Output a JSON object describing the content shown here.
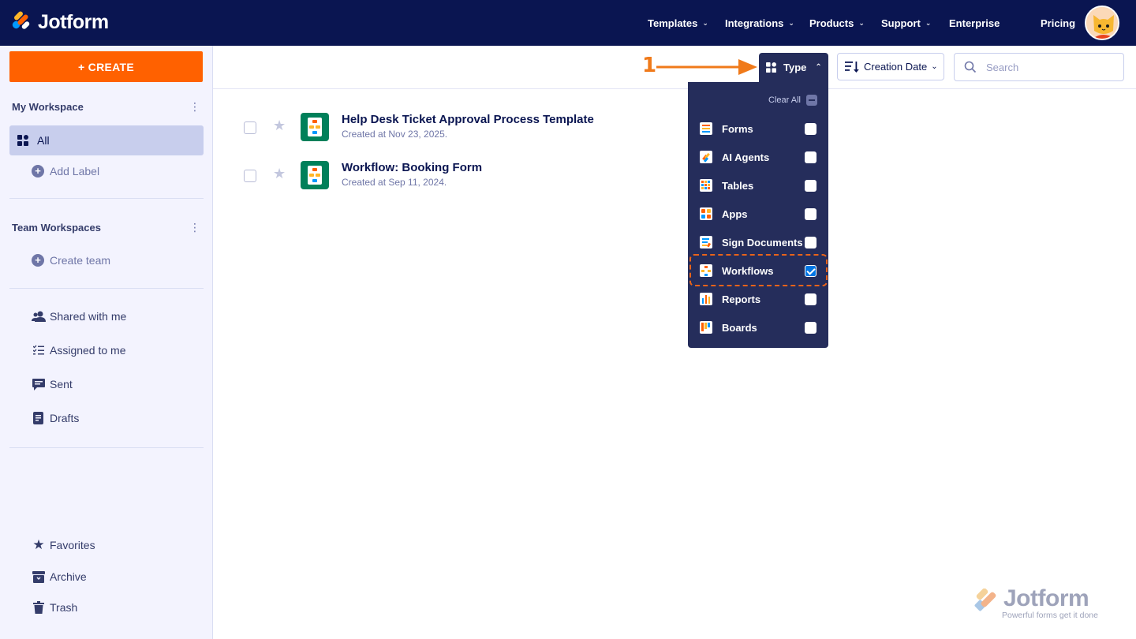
{
  "header": {
    "brand": "Jotform",
    "nav": [
      {
        "label": "Templates",
        "chevron": true
      },
      {
        "label": "Integrations",
        "chevron": true
      },
      {
        "label": "Products",
        "chevron": true
      },
      {
        "label": "Support",
        "chevron": true
      },
      {
        "label": "Enterprise",
        "chevron": false
      },
      {
        "label": "Pricing",
        "chevron": false
      }
    ],
    "avatar_icon": "user-avatar"
  },
  "sidebar": {
    "create_label": "+ CREATE",
    "my_workspace_title": "My Workspace",
    "all_label": "All",
    "add_label": "Add Label",
    "team_workspaces_title": "Team Workspaces",
    "create_team": "Create team",
    "shared_with_me": "Shared with me",
    "assigned_to_me": "Assigned to me",
    "sent": "Sent",
    "drafts": "Drafts",
    "favorites": "Favorites",
    "archive": "Archive",
    "trash": "Trash"
  },
  "toolbar": {
    "type_label": "Type",
    "sort_label": "Creation Date",
    "search_placeholder": "Search"
  },
  "annotation": {
    "step": "1",
    "color": "#f07a1a"
  },
  "type_filter": {
    "clear_all": "Clear All",
    "options": [
      {
        "label": "Forms",
        "checked": false,
        "icon": "forms-icon"
      },
      {
        "label": "AI Agents",
        "checked": false,
        "icon": "ai-agents-icon"
      },
      {
        "label": "Tables",
        "checked": false,
        "icon": "tables-icon"
      },
      {
        "label": "Apps",
        "checked": false,
        "icon": "apps-icon"
      },
      {
        "label": "Sign Documents",
        "checked": false,
        "icon": "sign-documents-icon"
      },
      {
        "label": "Workflows",
        "checked": true,
        "icon": "workflows-icon"
      },
      {
        "label": "Reports",
        "checked": false,
        "icon": "reports-icon"
      },
      {
        "label": "Boards",
        "checked": false,
        "icon": "boards-icon"
      }
    ]
  },
  "items": [
    {
      "title": "Help Desk Ticket Approval Process Template",
      "created": "Created at Nov 23, 2025."
    },
    {
      "title": "Workflow: Booking Form",
      "created": "Created at Sep 11, 2024."
    }
  ],
  "watermark": {
    "brand": "Jotform",
    "tagline": "Powerful forms get it done"
  },
  "colors": {
    "navy": "#0a1551",
    "create": "#ff6100",
    "dropdown": "#252d5b",
    "check": "#0075e3",
    "workflow": "#00805a"
  }
}
